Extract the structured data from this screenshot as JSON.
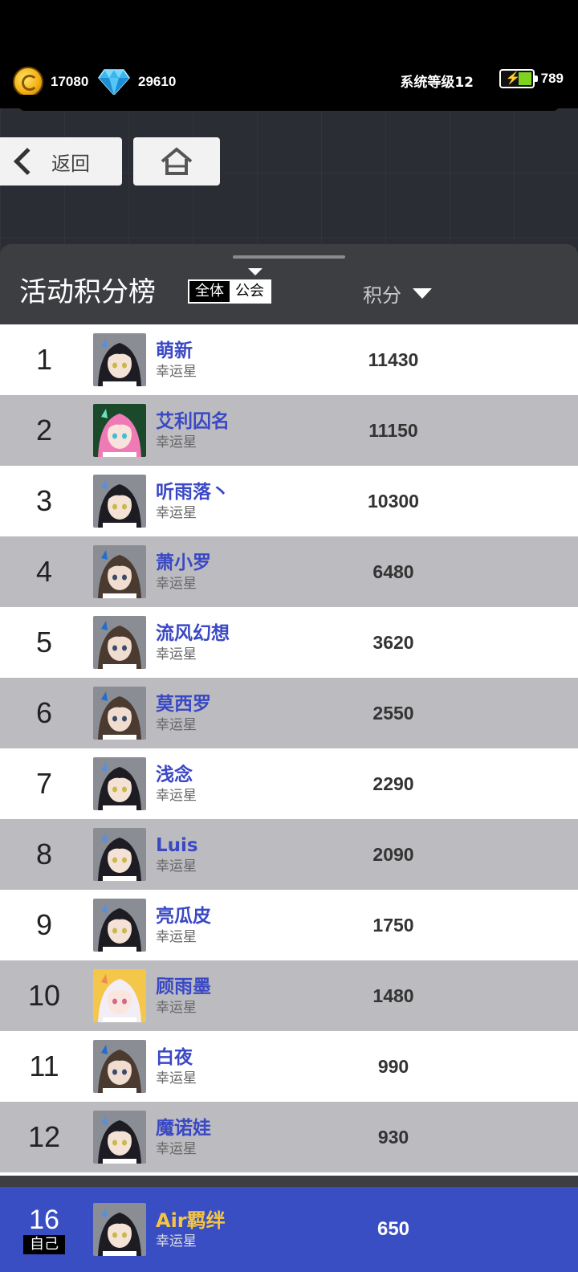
{
  "currency": {
    "coins": "17080",
    "gems": "29610",
    "coin_icon": "gold-coin-icon",
    "gem_icon": "diamond-icon"
  },
  "system_level": "系统等级12",
  "stamina": {
    "value": "789",
    "icon": "battery-icon"
  },
  "nav": {
    "back_label": "返回",
    "home_icon": "home-icon"
  },
  "panel": {
    "title": "活动积分榜",
    "filter_all": "全体",
    "filter_guild": "公会",
    "score_header": "积分"
  },
  "colors": {
    "name_blue": "#3a48c4",
    "self_bar": "#3a4ec4",
    "self_name": "#f5c542"
  },
  "rows": [
    {
      "rank": "1",
      "name": "萌新",
      "title": "幸运星",
      "score": "11430",
      "avatar": "girl-avatar"
    },
    {
      "rank": "2",
      "name": "艾利囚名",
      "title": "幸运星",
      "score": "11150",
      "avatar": "pink-girl-avatar"
    },
    {
      "rank": "3",
      "name": "听雨落丶",
      "title": "幸运星",
      "score": "10300",
      "avatar": "girl-avatar"
    },
    {
      "rank": "4",
      "name": "萧小罗",
      "title": "幸运星",
      "score": "6480",
      "avatar": "boy-avatar"
    },
    {
      "rank": "5",
      "name": "流风幻想",
      "title": "幸运星",
      "score": "3620",
      "avatar": "boy-avatar"
    },
    {
      "rank": "6",
      "name": "莫西罗",
      "title": "幸运星",
      "score": "2550",
      "avatar": "boy-avatar"
    },
    {
      "rank": "7",
      "name": "浅念",
      "title": "幸运星",
      "score": "2290",
      "avatar": "girl-avatar"
    },
    {
      "rank": "8",
      "name": "Luis",
      "title": "幸运星",
      "score": "2090",
      "avatar": "girl-avatar"
    },
    {
      "rank": "9",
      "name": "亮瓜皮",
      "title": "幸运星",
      "score": "1750",
      "avatar": "girl-avatar"
    },
    {
      "rank": "10",
      "name": "顾雨墨",
      "title": "幸运星",
      "score": "1480",
      "avatar": "white-hair-girl-avatar"
    },
    {
      "rank": "11",
      "name": "白夜",
      "title": "幸运星",
      "score": "990",
      "avatar": "boy-avatar"
    },
    {
      "rank": "12",
      "name": "魔诺娃",
      "title": "幸运星",
      "score": "930",
      "avatar": "girl-avatar"
    },
    {
      "rank": "",
      "name": "",
      "title": "",
      "score": "",
      "avatar": "girl-avatar"
    }
  ],
  "self": {
    "rank": "16",
    "tag": "自己",
    "name": "Air羁绊",
    "title": "幸运星",
    "score": "650",
    "avatar": "girl-avatar"
  }
}
